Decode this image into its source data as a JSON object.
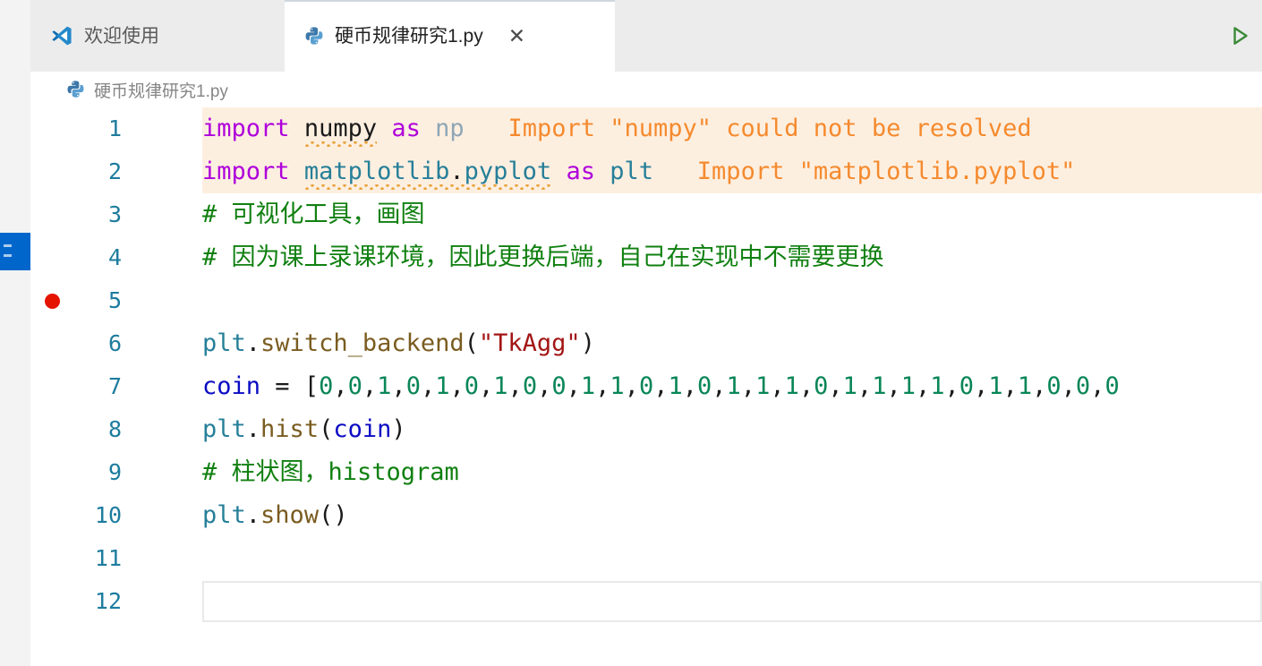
{
  "window": {
    "tabs": [
      {
        "label": "欢迎使用",
        "icon": "vscode-logo-icon",
        "active": false,
        "closable": false
      },
      {
        "label": "硬币规律研究1.py",
        "icon": "python-file-icon",
        "active": true,
        "closable": true,
        "close_label": "✕"
      }
    ],
    "run_button_label": "▷"
  },
  "breadcrumb": {
    "icon": "python-file-icon",
    "path": "硬币规律研究1.py"
  },
  "editor": {
    "gutter_line_numbers": [
      "1",
      "2",
      "3",
      "4",
      "5",
      "6",
      "7",
      "8",
      "9",
      "10",
      "11",
      "12"
    ],
    "breakpoint_line": "5",
    "cursor_line": "12",
    "lines": [
      {
        "n": "1",
        "text": "import numpy as np",
        "tokens": [
          {
            "t": "import",
            "c": "t-kw"
          },
          {
            "t": " ",
            "c": "t-plain"
          },
          {
            "t": "numpy",
            "c": "t-plain"
          },
          {
            "t": " ",
            "c": "t-plain"
          },
          {
            "t": "as",
            "c": "t-kw"
          },
          {
            "t": " ",
            "c": "t-plain"
          },
          {
            "t": "np",
            "c": "t-dim"
          }
        ],
        "inline_error": "Import \"numpy\" could not be resolved",
        "has_error_background": true,
        "has_squiggle": true
      },
      {
        "n": "2",
        "text": "import matplotlib.pyplot as plt",
        "tokens": [
          {
            "t": "import",
            "c": "t-kw"
          },
          {
            "t": " ",
            "c": "t-plain"
          },
          {
            "t": "matplotlib",
            "c": "t-mod"
          },
          {
            "t": ".",
            "c": "t-punc"
          },
          {
            "t": "pyplot",
            "c": "t-mod"
          },
          {
            "t": " ",
            "c": "t-plain"
          },
          {
            "t": "as",
            "c": "t-kw"
          },
          {
            "t": " ",
            "c": "t-plain"
          },
          {
            "t": "plt",
            "c": "t-mod"
          }
        ],
        "inline_error": "Import \"matplotlib.pyplot\"",
        "has_error_background": true,
        "has_squiggle": true
      },
      {
        "n": "3",
        "text": "# 可视化工具，画图",
        "tokens": [
          {
            "t": "# 可视化工具，画图",
            "c": "t-cmt"
          }
        ],
        "inline_error": "",
        "has_error_background": false,
        "has_squiggle": false
      },
      {
        "n": "4",
        "text": "# 因为课上录课环境，因此更换后端，自己在实现中不需要更换",
        "tokens": [
          {
            "t": "# 因为课上录课环境，因此更换后端，自己在实现中不需要更换",
            "c": "t-cmt"
          }
        ],
        "inline_error": "",
        "has_error_background": false,
        "has_squiggle": false
      },
      {
        "n": "5",
        "text": "",
        "tokens": [],
        "inline_error": "",
        "has_error_background": false,
        "has_squiggle": false
      },
      {
        "n": "6",
        "text": "plt.switch_backend(\"TkAgg\")",
        "tokens": [
          {
            "t": "plt",
            "c": "t-mod"
          },
          {
            "t": ".",
            "c": "t-punc"
          },
          {
            "t": "switch_backend",
            "c": "t-func"
          },
          {
            "t": "(",
            "c": "t-punc"
          },
          {
            "t": "\"TkAgg\"",
            "c": "t-str"
          },
          {
            "t": ")",
            "c": "t-punc"
          }
        ],
        "inline_error": "",
        "has_error_background": false,
        "has_squiggle": false
      },
      {
        "n": "7",
        "text": "coin = [0,0,1,0,1,0,1,0,0,1,1,0,1,0,1,1,1,0,1,1,1,1,0,1,1,0,0,0",
        "tokens": [
          {
            "t": "coin",
            "c": "t-var"
          },
          {
            "t": " ",
            "c": "t-plain"
          },
          {
            "t": "=",
            "c": "t-punc"
          },
          {
            "t": " ",
            "c": "t-plain"
          },
          {
            "t": "[",
            "c": "t-punc"
          },
          {
            "t": "0",
            "c": "t-num"
          },
          {
            "t": ",",
            "c": "t-punc"
          },
          {
            "t": "0",
            "c": "t-num"
          },
          {
            "t": ",",
            "c": "t-punc"
          },
          {
            "t": "1",
            "c": "t-num"
          },
          {
            "t": ",",
            "c": "t-punc"
          },
          {
            "t": "0",
            "c": "t-num"
          },
          {
            "t": ",",
            "c": "t-punc"
          },
          {
            "t": "1",
            "c": "t-num"
          },
          {
            "t": ",",
            "c": "t-punc"
          },
          {
            "t": "0",
            "c": "t-num"
          },
          {
            "t": ",",
            "c": "t-punc"
          },
          {
            "t": "1",
            "c": "t-num"
          },
          {
            "t": ",",
            "c": "t-punc"
          },
          {
            "t": "0",
            "c": "t-num"
          },
          {
            "t": ",",
            "c": "t-punc"
          },
          {
            "t": "0",
            "c": "t-num"
          },
          {
            "t": ",",
            "c": "t-punc"
          },
          {
            "t": "1",
            "c": "t-num"
          },
          {
            "t": ",",
            "c": "t-punc"
          },
          {
            "t": "1",
            "c": "t-num"
          },
          {
            "t": ",",
            "c": "t-punc"
          },
          {
            "t": "0",
            "c": "t-num"
          },
          {
            "t": ",",
            "c": "t-punc"
          },
          {
            "t": "1",
            "c": "t-num"
          },
          {
            "t": ",",
            "c": "t-punc"
          },
          {
            "t": "0",
            "c": "t-num"
          },
          {
            "t": ",",
            "c": "t-punc"
          },
          {
            "t": "1",
            "c": "t-num"
          },
          {
            "t": ",",
            "c": "t-punc"
          },
          {
            "t": "1",
            "c": "t-num"
          },
          {
            "t": ",",
            "c": "t-punc"
          },
          {
            "t": "1",
            "c": "t-num"
          },
          {
            "t": ",",
            "c": "t-punc"
          },
          {
            "t": "0",
            "c": "t-num"
          },
          {
            "t": ",",
            "c": "t-punc"
          },
          {
            "t": "1",
            "c": "t-num"
          },
          {
            "t": ",",
            "c": "t-punc"
          },
          {
            "t": "1",
            "c": "t-num"
          },
          {
            "t": ",",
            "c": "t-punc"
          },
          {
            "t": "1",
            "c": "t-num"
          },
          {
            "t": ",",
            "c": "t-punc"
          },
          {
            "t": "1",
            "c": "t-num"
          },
          {
            "t": ",",
            "c": "t-punc"
          },
          {
            "t": "0",
            "c": "t-num"
          },
          {
            "t": ",",
            "c": "t-punc"
          },
          {
            "t": "1",
            "c": "t-num"
          },
          {
            "t": ",",
            "c": "t-punc"
          },
          {
            "t": "1",
            "c": "t-num"
          },
          {
            "t": ",",
            "c": "t-punc"
          },
          {
            "t": "0",
            "c": "t-num"
          },
          {
            "t": ",",
            "c": "t-punc"
          },
          {
            "t": "0",
            "c": "t-num"
          },
          {
            "t": ",",
            "c": "t-punc"
          },
          {
            "t": "0",
            "c": "t-num"
          }
        ],
        "inline_error": "",
        "has_error_background": false,
        "has_squiggle": false
      },
      {
        "n": "8",
        "text": "plt.hist(coin)",
        "tokens": [
          {
            "t": "plt",
            "c": "t-mod"
          },
          {
            "t": ".",
            "c": "t-punc"
          },
          {
            "t": "hist",
            "c": "t-func"
          },
          {
            "t": "(",
            "c": "t-punc"
          },
          {
            "t": "coin",
            "c": "t-var"
          },
          {
            "t": ")",
            "c": "t-punc"
          }
        ],
        "inline_error": "",
        "has_error_background": false,
        "has_squiggle": false
      },
      {
        "n": "9",
        "text": "# 柱状图，histogram",
        "tokens": [
          {
            "t": "# 柱状图，histogram",
            "c": "t-cmt"
          }
        ],
        "inline_error": "",
        "has_error_background": false,
        "has_squiggle": false
      },
      {
        "n": "10",
        "text": "plt.show()",
        "tokens": [
          {
            "t": "plt",
            "c": "t-mod"
          },
          {
            "t": ".",
            "c": "t-punc"
          },
          {
            "t": "show",
            "c": "t-func"
          },
          {
            "t": "(",
            "c": "t-punc"
          },
          {
            "t": ")",
            "c": "t-punc"
          }
        ],
        "inline_error": "",
        "has_error_background": false,
        "has_squiggle": false
      },
      {
        "n": "11",
        "text": "",
        "tokens": [],
        "inline_error": "",
        "has_error_background": false,
        "has_squiggle": false
      },
      {
        "n": "12",
        "text": "",
        "tokens": [],
        "inline_error": "",
        "has_error_background": false,
        "has_squiggle": false
      }
    ]
  },
  "colors": {
    "error_background": "#fdefe0",
    "error_text": "#f58a2e",
    "squiggle": "#e8a33d",
    "breakpoint": "#e51400",
    "keyword": "#af00db",
    "module": "#267f99",
    "string": "#a31515",
    "number": "#098658",
    "comment": "#108010",
    "variable": "#0b0bc4",
    "function": "#7a5c20",
    "line_number": "#1d7c9e",
    "tabstrip_background": "#ececec",
    "active_tab_background": "#ffffff",
    "activity_badge": "#0066cc",
    "run_icon": "#3a8a38"
  }
}
